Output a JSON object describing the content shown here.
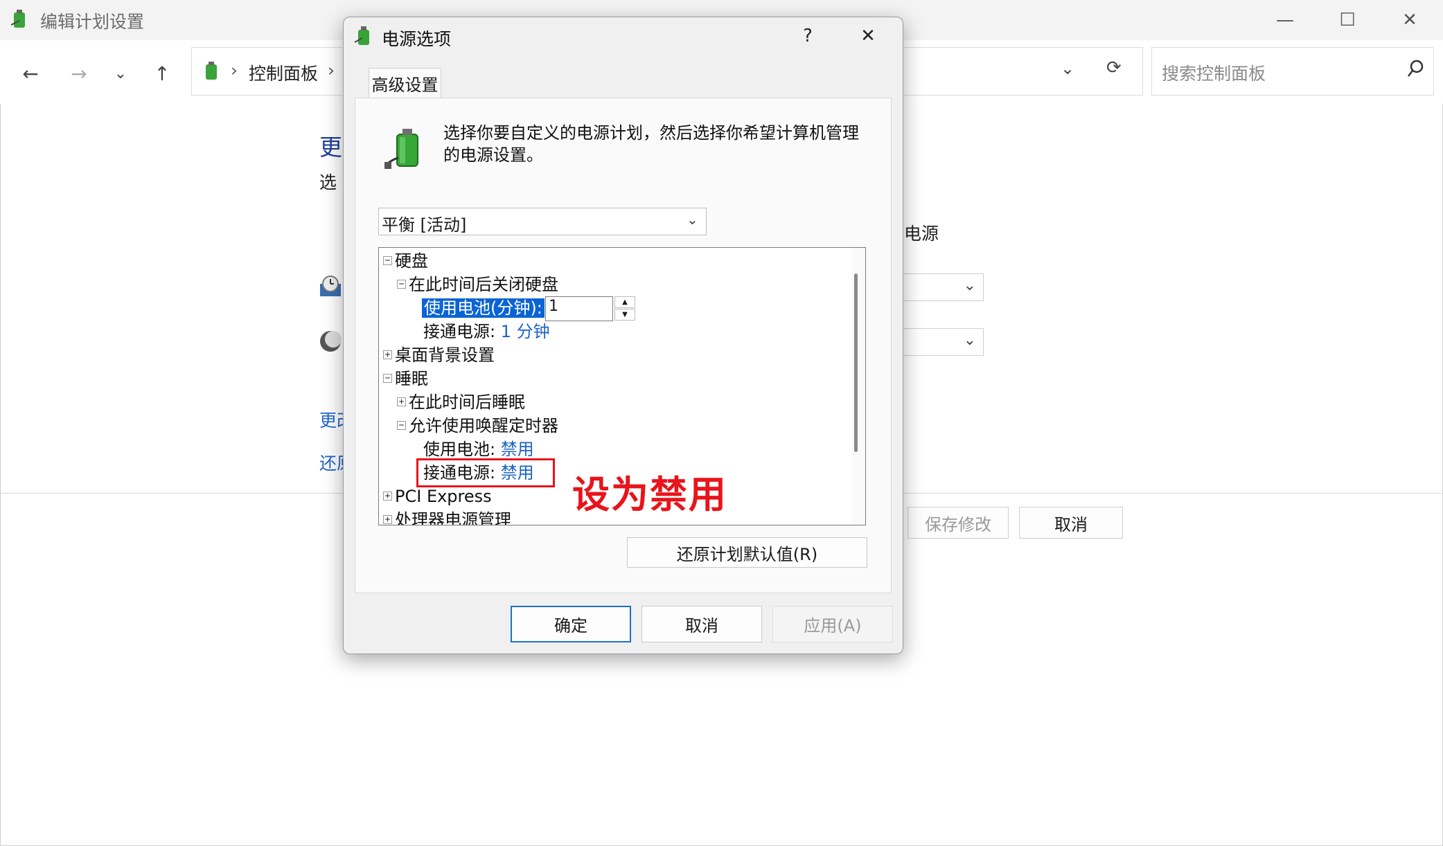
{
  "background_window": {
    "title": "编辑计划设置",
    "breadcrumb": "控制面板",
    "breadcrumb_sep": "›",
    "breadcrumb_tail": "›",
    "search_placeholder": "搜索控制面板",
    "heading_partial": "更",
    "subtitle_partial": "选",
    "power_label_partial": "电源",
    "link1_partial": "更改",
    "link2_partial": "还原",
    "save_button": "保存修改",
    "cancel_button": "取消"
  },
  "dialog": {
    "title": "电源选项",
    "help": "?",
    "close": "✕",
    "tab": "高级设置",
    "description": "选择你要自定义的电源计划，然后选择你希望计算机管理的电源设置。",
    "plan_selected": "平衡 [活动]",
    "tree": {
      "hard_disk": "硬盘",
      "turn_off_disk_after": "在此时间后关闭硬盘",
      "on_battery_label": "使用电池(分钟):",
      "on_battery_value": "1",
      "plugged_in_label": "接通电源:",
      "plugged_in_value": "1 分钟",
      "desktop_background": "桌面背景设置",
      "sleep": "睡眠",
      "sleep_after": "在此时间后睡眠",
      "wake_timers": "允许使用唤醒定时器",
      "wake_battery_label": "使用电池:",
      "wake_battery_value": "禁用",
      "wake_plugged_label": "接通电源:",
      "wake_plugged_value": "禁用",
      "pci_express": "PCI Express",
      "processor_power": "处理器电源管理"
    },
    "restore_button": "还原计划默认值(R)",
    "ok_button": "确定",
    "cancel_button": "取消",
    "apply_button": "应用(A)"
  },
  "annotation": {
    "text": "设为禁用",
    "color": "#e8141b"
  }
}
